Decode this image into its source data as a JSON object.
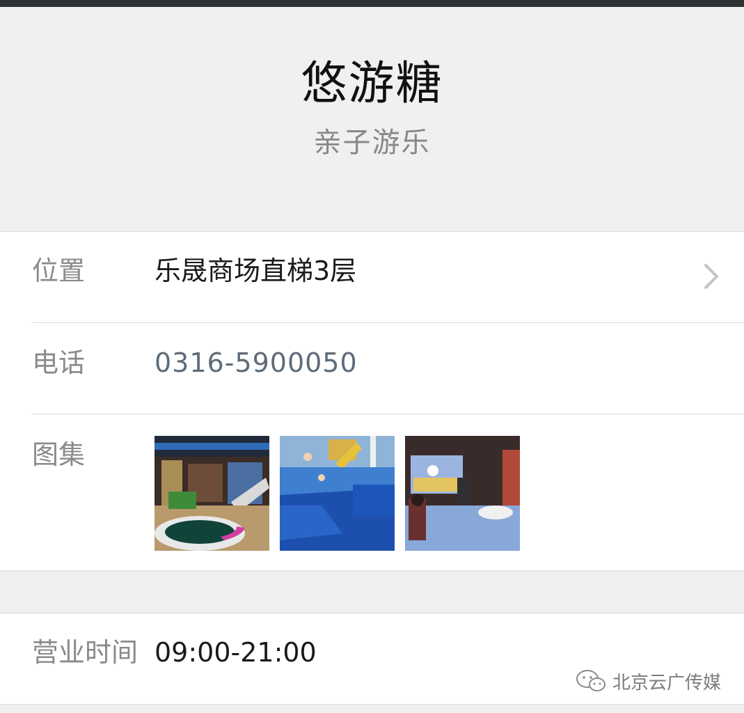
{
  "header": {
    "title": "悠游糖",
    "subtitle": "亲子游乐"
  },
  "info": {
    "location_label": "位置",
    "location_value": "乐晟商场直梯3层",
    "phone_label": "电话",
    "phone_value": "0316-5900050",
    "gallery_label": "图集",
    "gallery_icons": [
      "playground-photo",
      "ball-pool-photo",
      "projection-game-photo"
    ]
  },
  "hours": {
    "label": "营业时间",
    "value": "09:00-21:00"
  },
  "watermark": {
    "text": "北京云广传媒",
    "icon": "wechat-icon"
  },
  "colors": {
    "background": "#eff0f2",
    "card": "#ffffff",
    "phone": "#5d6b79",
    "label": "#8a8a8a"
  }
}
